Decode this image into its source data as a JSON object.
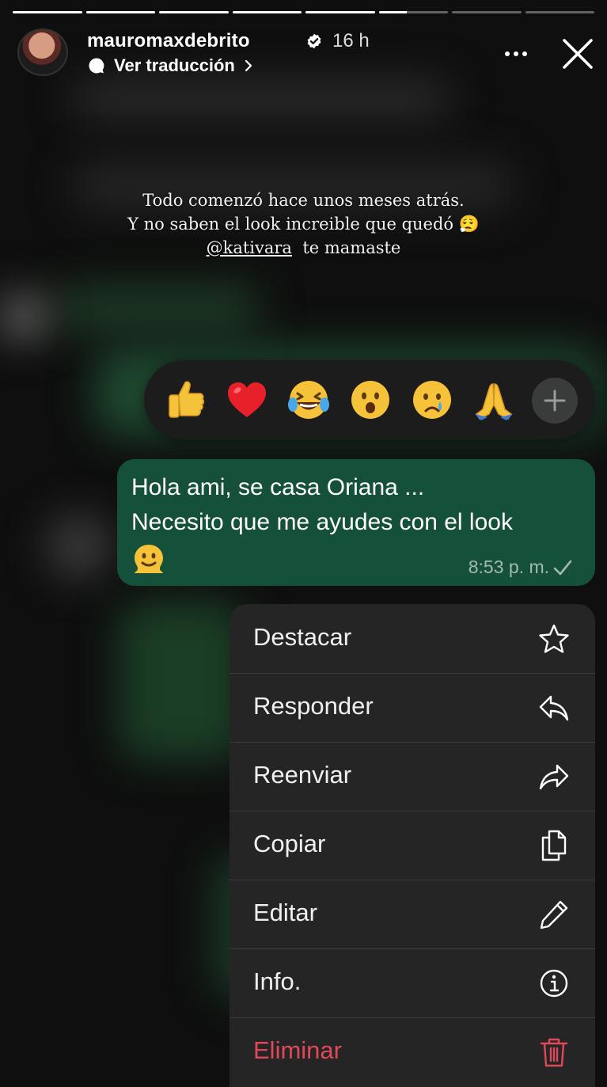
{
  "story": {
    "username": "mauromaxdebrito",
    "time_ago": "16 h",
    "translate_label": "Ver traducción",
    "progress_segments": [
      1,
      1,
      1,
      1,
      1,
      0.4,
      0,
      0
    ]
  },
  "caption": {
    "line1": "Todo comenzó hace unos meses atrás.",
    "line2": "Y no saben el look increible que quedó 😮‍💨",
    "mention": "@kativara",
    "line3_rest": "te mamaste"
  },
  "reactions": [
    "👍",
    "❤️",
    "😂",
    "😮",
    "😢",
    "🙏"
  ],
  "message": {
    "line1": "Hola ami, se casa Oriana ...",
    "line2": "Necesito que me ayudes con el look",
    "emoji": "🫠",
    "time": "8:53 p. m."
  },
  "menu": {
    "items": [
      {
        "label": "Destacar",
        "icon": "star-icon"
      },
      {
        "label": "Responder",
        "icon": "reply-icon"
      },
      {
        "label": "Reenviar",
        "icon": "forward-icon"
      },
      {
        "label": "Copiar",
        "icon": "copy-icon"
      },
      {
        "label": "Editar",
        "icon": "pencil-icon"
      },
      {
        "label": "Info.",
        "icon": "info-icon"
      },
      {
        "label": "Eliminar",
        "icon": "trash-icon"
      }
    ]
  },
  "colors": {
    "bubble": "#14503a",
    "menu_bg": "#242524",
    "danger": "#e0495a"
  }
}
